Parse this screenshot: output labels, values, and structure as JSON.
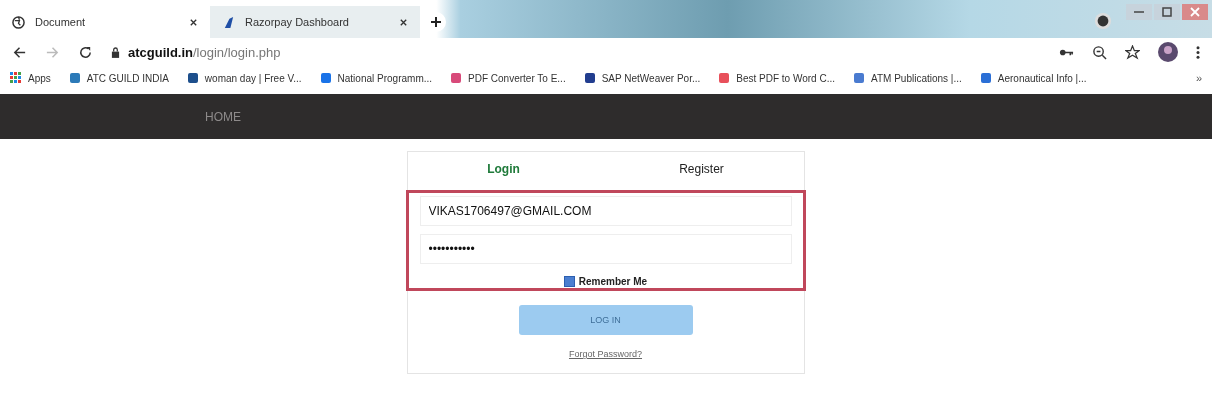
{
  "browser": {
    "tabs": [
      {
        "title": "Document",
        "selected": true
      },
      {
        "title": "Razorpay Dashboard",
        "selected": false
      }
    ],
    "address": {
      "host": "atcguild.in",
      "path": "/login/login.php"
    },
    "bookmarks": [
      "Apps",
      "ATC GUILD INDIA",
      "woman day | Free V...",
      "National Programm...",
      "PDF Converter To E...",
      "SAP NetWeaver Por...",
      "Best PDF to Word C...",
      "ATM Publications |...",
      "Aeronautical Info |..."
    ],
    "overflow": "»"
  },
  "nav": {
    "items": [
      "HOME"
    ]
  },
  "login": {
    "tabs": [
      {
        "label": "Login",
        "selected": true
      },
      {
        "label": "Register",
        "selected": false
      }
    ],
    "email": "VIKAS1706497@GMAIL.COM",
    "password": "•••••••••••",
    "highlighted": true,
    "remember": {
      "label": "Remember Me",
      "checked": true
    },
    "button": {
      "label": "LOG IN",
      "disabled": true
    },
    "forgot": "Forgot Password?"
  }
}
